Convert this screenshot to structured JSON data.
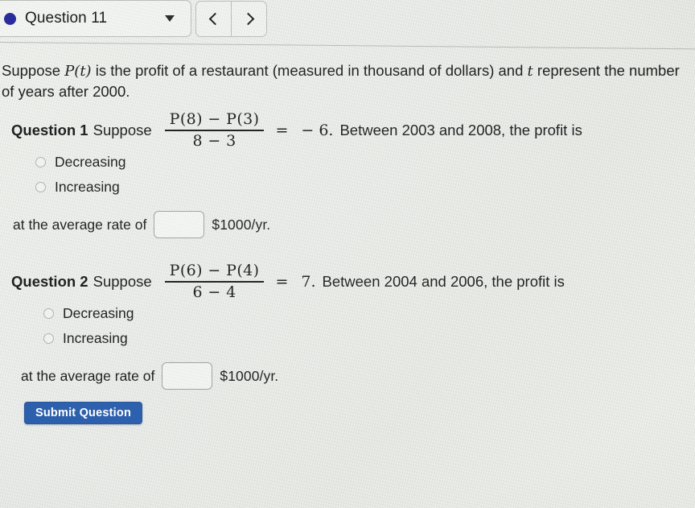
{
  "header": {
    "question_selector": {
      "label": "Question 11",
      "bullet_color": "#2b2c9c",
      "caret_icon": "chevron-down-icon"
    },
    "prev_label": "‹",
    "next_label": "›"
  },
  "intro": {
    "part1": "Suppose ",
    "var_pt": "P(t)",
    "part2": " is the profit of a restaurant (measured in thousand of dollars) and ",
    "var_t": "t",
    "part3": " represent the number of years after 2000."
  },
  "questions": [
    {
      "number_label": "Question 1",
      "suppose_label": "Suppose",
      "fraction": {
        "numerator": "P(8) − P(3)",
        "denominator": "8 − 3"
      },
      "equals": "=",
      "value": "− 6.",
      "tail": "Between 2003 and 2008, the profit is",
      "options": [
        {
          "label": "Decreasing",
          "selected": false
        },
        {
          "label": "Increasing",
          "selected": false
        }
      ],
      "answer_prefix": "at the average rate of",
      "answer_value": "",
      "answer_placeholder": "",
      "answer_units": "$1000/yr."
    },
    {
      "number_label": "Question 2",
      "suppose_label": "Suppose",
      "fraction": {
        "numerator": "P(6) − P(4)",
        "denominator": "6 − 4"
      },
      "equals": "=",
      "value": "7.",
      "tail": "Between 2004 and 2006, the profit is",
      "options": [
        {
          "label": "Decreasing",
          "selected": false
        },
        {
          "label": "Increasing",
          "selected": false
        }
      ],
      "answer_prefix": "at the average rate of",
      "answer_value": "",
      "answer_placeholder": "",
      "answer_units": "$1000/yr."
    }
  ],
  "submit": {
    "label": "Submit Question",
    "color": "#2b5fac"
  }
}
